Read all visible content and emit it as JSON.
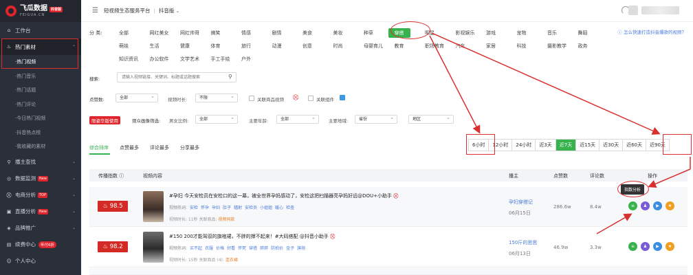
{
  "brand": {
    "name": "飞瓜数据",
    "sub": "FEIGUA.CN",
    "badge": "抖音版"
  },
  "sidebar": {
    "items": [
      {
        "label": "工作台",
        "icon": "home-icon"
      },
      {
        "label": "热门素材",
        "icon": "flame-icon"
      }
    ],
    "sub_items": [
      "热门视频",
      "热门音乐",
      "热门话题",
      "热门评论",
      "今日热门视频",
      "抖音热点榜",
      "我收藏的素材"
    ],
    "lower_items": [
      {
        "label": "播主查找",
        "icon": "search-icon",
        "badge": ""
      },
      {
        "label": "数据监测",
        "icon": "monitor-icon",
        "badge": "New"
      },
      {
        "label": "电商分析",
        "icon": "cart-icon",
        "badge": "TOP"
      },
      {
        "label": "直播分析",
        "icon": "live-icon",
        "badge": "New"
      },
      {
        "label": "品牌推广",
        "icon": "brand-icon",
        "badge": ""
      },
      {
        "label": "续费中心",
        "icon": "renew-icon",
        "badge": "年付6折"
      },
      {
        "label": "个人中心",
        "icon": "user-icon",
        "badge": ""
      }
    ]
  },
  "topbar": {
    "breadcrumb_1": "短视频生态服务平台",
    "breadcrumb_2": "抖音版"
  },
  "filters": {
    "category_label": "分  类:",
    "help_link": "ⓘ 怎么快速打造抖音爆款的视频？",
    "row1": [
      "全部",
      "网红美女",
      "网红帅哥",
      "搞笑",
      "情感",
      "剧情",
      "美食",
      "美妆",
      "种草",
      "穿搭",
      "明星",
      "影视娱乐",
      "游戏",
      "宠物",
      "音乐",
      "舞蹈"
    ],
    "row2": [
      "萌娃",
      "生活",
      "健康",
      "体育",
      "旅行",
      "动漫",
      "创意",
      "时尚",
      "母婴育儿",
      "教育",
      "职场教育",
      "汽车",
      "家居",
      "科技",
      "摄影教学",
      "政务"
    ],
    "row3": [
      "知识资讯",
      "办公软件",
      "文学艺术",
      "手工手绘",
      "户外"
    ],
    "selected": "穿搭",
    "search_label": "搜索:",
    "search_placeholder": "请输入视频链接、关键词、标题或话题搜索",
    "likes_label": "点赞数:",
    "likes_value": "全部",
    "duration_label": "视频时长:",
    "duration_value": "不限",
    "goods_label": "关联商品视频",
    "component_label": "关联组件",
    "limited_label": "限姿华版使用",
    "audience_label": "观众画像筛选:",
    "gender_label": "男女比例:",
    "gender_value": "全部",
    "age_label": "主要年龄:",
    "age_value": "全部",
    "region_label": "主要地域:",
    "region_value": "省份",
    "city_value": "地区"
  },
  "sort_tabs": [
    "综合排序",
    "点赞最多",
    "评论最多",
    "分享最多"
  ],
  "time_ranges": [
    "6小时",
    "12小时",
    "24小时",
    "近3天",
    "近7天",
    "近15天",
    "近30天",
    "近60天",
    "近90天"
  ],
  "time_active": "近7天",
  "table": {
    "headers": {
      "index": "传播指数 ⓘ",
      "content": "视频内容",
      "author": "播主",
      "likes": "点赞数",
      "comments": "评论数",
      "ops": "操作"
    },
    "rows": [
      {
        "score": "98.5",
        "title": "#孕妇 今天安检员在安检口的这一幕，被全世界孕妈感动了，安检这把扫描器亮孕妈好远@DOU+小助手",
        "tags_label": "视频热词:",
        "tags": [
          "安检",
          "怀孕",
          "孕妇",
          "肚子",
          "辐射",
          "安检员",
          "小姐姐",
          "暖心",
          "检查"
        ],
        "meta": "视频时长: 11秒    关联商品: ",
        "meta_link": "视频同款",
        "author": "孕妇穿搭记",
        "date": "06月15日",
        "likes": "286.6w",
        "comments": "8.4w"
      },
      {
        "score": "98.2",
        "title": "#150 200才能驾驭的旗袍裙，不胖的撑不起来！#大码搭配 @抖音小助手",
        "tags_label": "视频热词:",
        "tags": [
          "买不起",
          "衣服",
          "价格",
          "好看",
          "怀死",
          "穿搭",
          "胖胖",
          "防拍价",
          "金子",
          "旗袍"
        ],
        "meta": "视频时长: 15秒    关联商品 (4): ",
        "meta_link": "连衣裙",
        "author": "150斤的思思",
        "date": "06月13日",
        "likes": "46.9w",
        "comments": "3.3w"
      }
    ],
    "tooltip": "指数分析"
  },
  "colors": {
    "accent": "#37b24d",
    "score_red": "#d42a25",
    "annotation": "#d9302f"
  }
}
